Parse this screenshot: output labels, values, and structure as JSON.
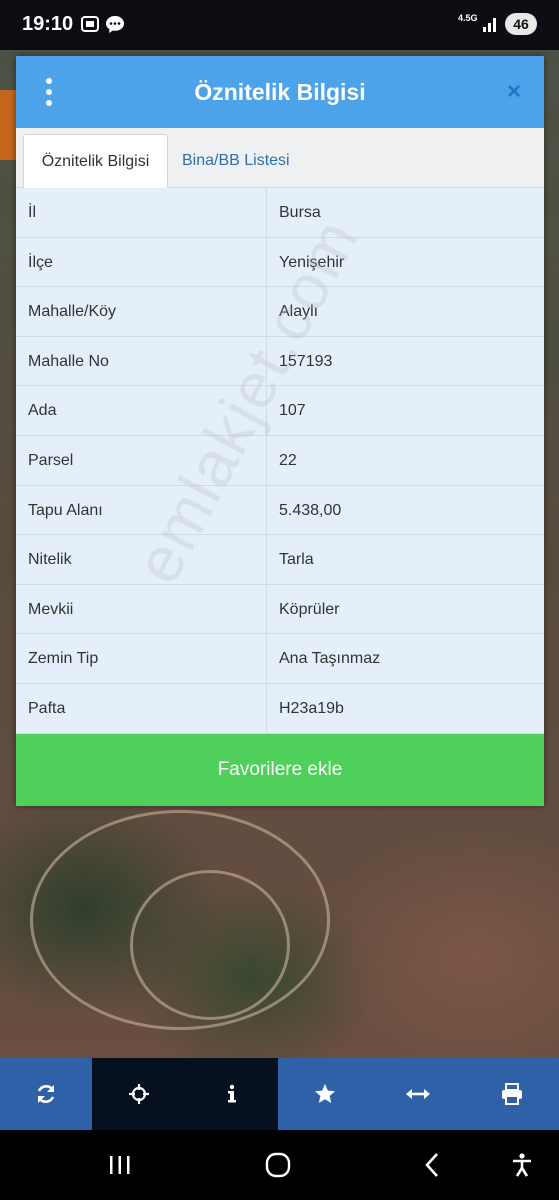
{
  "status_bar": {
    "time": "19:10",
    "network": "4.5G",
    "battery": "46"
  },
  "dialog": {
    "title": "Öznitelik Bilgisi",
    "close_label": "×",
    "tabs": [
      {
        "label": "Öznitelik Bilgisi",
        "active": true
      },
      {
        "label": "Bina/BB Listesi",
        "active": false
      }
    ],
    "rows": [
      {
        "key": "İl",
        "value": "Bursa"
      },
      {
        "key": "İlçe",
        "value": "Yenişehir"
      },
      {
        "key": "Mahalle/Köy",
        "value": "Alaylı"
      },
      {
        "key": "Mahalle No",
        "value": "157193"
      },
      {
        "key": "Ada",
        "value": "107"
      },
      {
        "key": "Parsel",
        "value": "22"
      },
      {
        "key": "Tapu Alanı",
        "value": "5.438,00"
      },
      {
        "key": "Nitelik",
        "value": "Tarla"
      },
      {
        "key": "Mevkii",
        "value": "Köprüler"
      },
      {
        "key": "Zemin Tip",
        "value": "Ana Taşınmaz"
      },
      {
        "key": "Pafta",
        "value": "H23a19b"
      }
    ],
    "favorite_button": "Favorilere ekle"
  },
  "watermark": "emlakjet.com",
  "toolbar": {
    "tools": [
      {
        "icon": "refresh-icon",
        "active": false
      },
      {
        "icon": "crosshair-icon",
        "active": true
      },
      {
        "icon": "info-icon",
        "active": true
      },
      {
        "icon": "star-icon",
        "active": false
      },
      {
        "icon": "measure-icon",
        "active": false
      },
      {
        "icon": "print-icon",
        "active": false
      }
    ]
  },
  "colors": {
    "header": "#4da3ea",
    "favorite": "#4fd05a",
    "toolbar": "#2f61a8",
    "row_bg": "#e4eff9"
  }
}
